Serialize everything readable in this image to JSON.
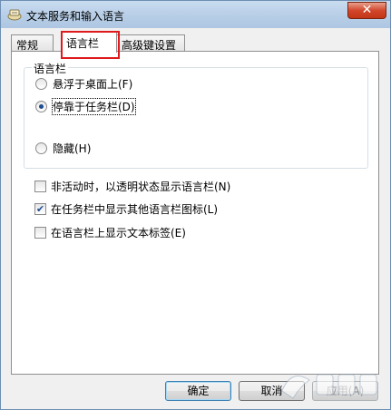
{
  "window": {
    "title": "文本服务和输入语言",
    "close_glyph": "✕"
  },
  "tabs": [
    {
      "label": "常规",
      "active": false
    },
    {
      "label": "语言栏",
      "active": true
    },
    {
      "label": "高级键设置",
      "active": false
    }
  ],
  "language_bar": {
    "group_title": "语言栏",
    "options": [
      {
        "label": "悬浮于桌面上(F)",
        "checked": false
      },
      {
        "label": "停靠于任务栏(D)",
        "checked": true
      },
      {
        "label": "隐藏(H)",
        "checked": false
      }
    ]
  },
  "checkboxes": [
    {
      "label": "非活动时，以透明状态显示语言栏(N)",
      "checked": false
    },
    {
      "label": "在任务栏中显示其他语言栏图标(L)",
      "checked": true
    },
    {
      "label": "在语言栏上显示文本标签(E)",
      "checked": false
    }
  ],
  "buttons": {
    "ok": "确定",
    "cancel": "取消",
    "apply": "应用(A)"
  },
  "colors": {
    "highlight_box": "#e0191d"
  }
}
